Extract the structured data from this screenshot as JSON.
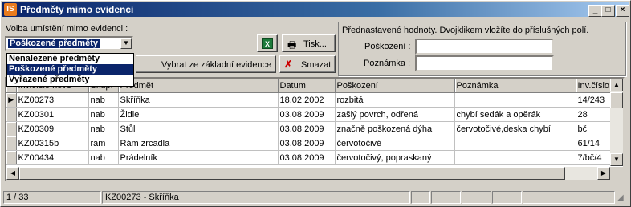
{
  "window": {
    "title": "Předměty mimo evidenci",
    "logo": "IS"
  },
  "title_buttons": {
    "minimize": "_",
    "maximize": "□",
    "close": "×"
  },
  "location": {
    "label": "Volba umístění mimo evidenci :",
    "selected": "Poškozené předměty",
    "options": [
      "Nenalezené předměty",
      "Poškozené předměty",
      "Vyřazené předměty"
    ]
  },
  "toolbar": {
    "excel_icon": "excel-icon",
    "print_label": "Tisk...",
    "choose_label": "Vybrat ze základní evidence",
    "delete_label": "Smazat"
  },
  "defaults": {
    "caption": "Přednastavené hodnoty. Dvojklikem vložíte do příslušných polí.",
    "damage_label": "Poškození :",
    "damage_value": "",
    "note_label": "Poznámka :",
    "note_value": ""
  },
  "grid": {
    "columns": [
      "Inv.číslo nové",
      "Skup.",
      "Předmět",
      "Datum",
      "Poškození",
      "Poznámka",
      "Inv.číslo"
    ],
    "rows": [
      [
        "KZ00273",
        "nab",
        "Skříňka",
        "18.02.2002",
        "rozbitá",
        "",
        "14/243"
      ],
      [
        "KZ00301",
        "nab",
        "Židle",
        "03.08.2009",
        "zašlý povrch, odřená",
        "chybí sedák a opěrák",
        "28"
      ],
      [
        "KZ00309",
        "nab",
        "Stůl",
        "03.08.2009",
        "značně poškozená dýha",
        "červotočivé,deska chybí",
        "bč"
      ],
      [
        "KZ00315b",
        "ram",
        "Rám zrcadla",
        "03.08.2009",
        "červotočivé",
        "",
        "61/14"
      ],
      [
        "KZ00434",
        "nab",
        "Prádelník",
        "03.08.2009",
        "červotočivý, popraskaný",
        "",
        "7/bč/4"
      ]
    ]
  },
  "status": {
    "position": "1 / 33",
    "current": "KZ00273 - Skříňka"
  }
}
